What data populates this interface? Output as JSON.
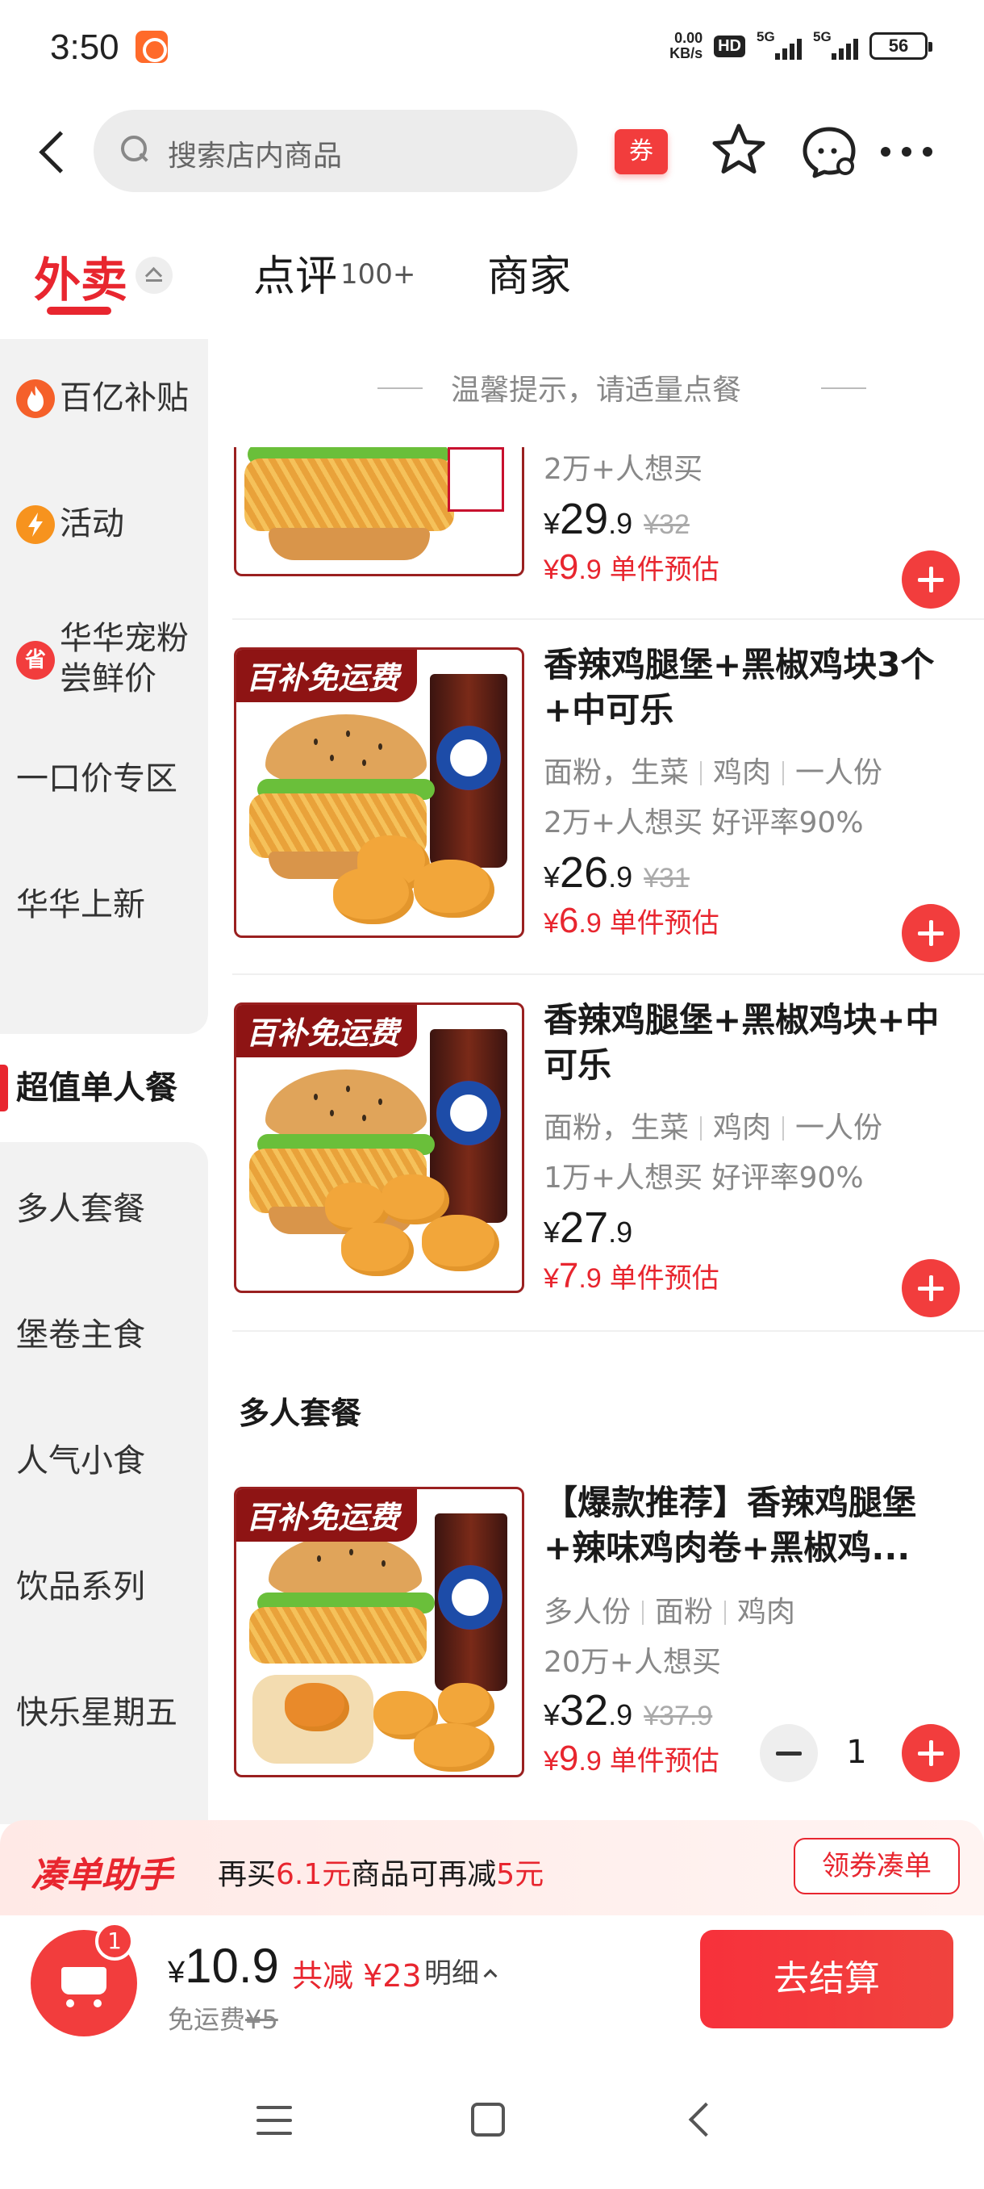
{
  "status_bar": {
    "time": "3:50",
    "net_speed_value": "0.00",
    "net_speed_unit": "KB/s",
    "hd": "HD",
    "signal1": "5G",
    "signal2": "5G",
    "battery": "56"
  },
  "header": {
    "search_placeholder": "搜索店内商品",
    "coupon_label": "券"
  },
  "tabs": {
    "delivery": "外卖",
    "review": "点评",
    "review_count": "100+",
    "merchant": "商家"
  },
  "sidebar": {
    "items": [
      {
        "label": "百亿补贴",
        "icon": "flame-icon"
      },
      {
        "label": "活动",
        "icon": "bolt-icon"
      },
      {
        "label": "华华宠粉尝鲜价",
        "line1": "华华宠粉",
        "line2": "尝鲜价",
        "icon_text": "省"
      },
      {
        "label": "一口价专区"
      },
      {
        "label": "华华上新"
      },
      {
        "label": "超值单人餐"
      },
      {
        "label": "多人套餐"
      },
      {
        "label": "堡卷主食"
      },
      {
        "label": "人气小食"
      },
      {
        "label": "饮品系列"
      },
      {
        "label": "快乐星期五"
      }
    ]
  },
  "content": {
    "tip": "温馨提示，请适量点餐",
    "badge": "百补免运费",
    "estimate_label": "单件预估",
    "products": [
      {
        "sales": "2万+人想买",
        "price_int": "29",
        "price_dec": ".9",
        "orig_price": "¥32",
        "est_int": "9",
        "est_dec": ".9"
      },
      {
        "title": "香辣鸡腿堡+黑椒鸡块3个+中可乐",
        "tags": [
          "面粉，生菜",
          "鸡肉",
          "一人份"
        ],
        "sales": "2万+人想买 好评率90%",
        "price_int": "26",
        "price_dec": ".9",
        "orig_price": "¥31",
        "est_int": "6",
        "est_dec": ".9"
      },
      {
        "title": "香辣鸡腿堡+黑椒鸡块+中可乐",
        "tags": [
          "面粉，生菜",
          "鸡肉",
          "一人份"
        ],
        "sales": "1万+人想买 好评率90%",
        "price_int": "27",
        "price_dec": ".9",
        "est_int": "7",
        "est_dec": ".9"
      },
      {
        "title": "【爆款推荐】香辣鸡腿堡+辣味鸡肉卷+黑椒鸡...",
        "tags": [
          "多人份",
          "面粉",
          "鸡肉"
        ],
        "sales": "20万+人想买",
        "price_int": "32",
        "price_dec": ".9",
        "orig_price": "¥37.9",
        "est_int": "9",
        "est_dec": ".9",
        "quantity": "1"
      }
    ],
    "section_multi": "多人套餐"
  },
  "helper": {
    "brand": "凑单助手",
    "text_pre": "再买",
    "amount": "6.1元",
    "text_mid": "商品可再减",
    "discount": "5元",
    "button": "领券凑单"
  },
  "checkout": {
    "cart_count": "1",
    "total": "10.9",
    "discount": "共减 ¥23",
    "detail": "明细",
    "shipping_label": "免运费",
    "shipping_orig": "¥5",
    "button": "去结算"
  },
  "colors": {
    "accent": "#e8262f",
    "badge": "#8e1414"
  }
}
